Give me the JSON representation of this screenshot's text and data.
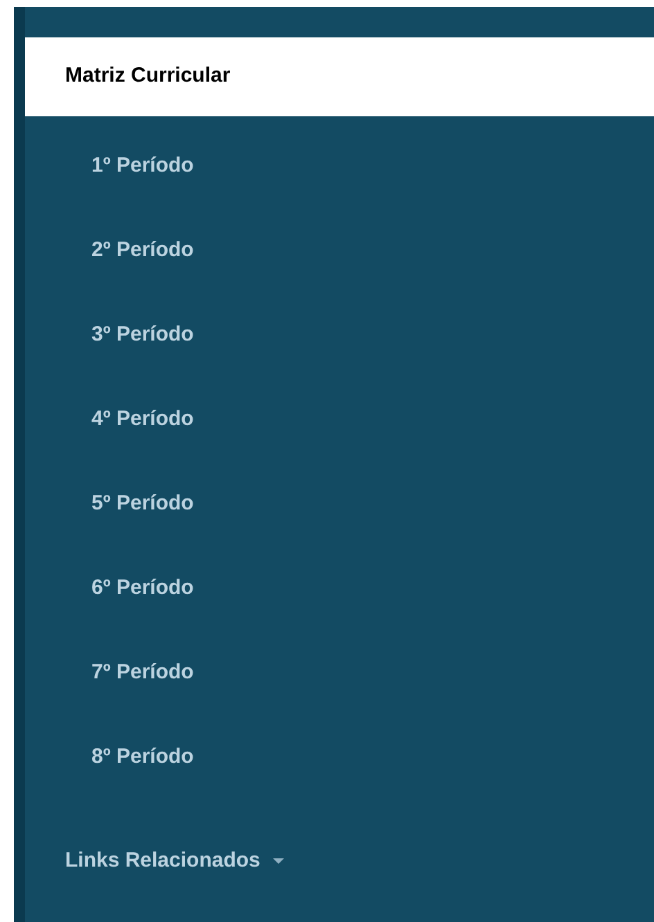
{
  "sidebar": {
    "items": [
      {
        "label": "Matriz Curricular",
        "selected": true,
        "children": [
          {
            "label": "1º Período",
            "selected": false
          },
          {
            "label": "2º Período",
            "selected": false
          },
          {
            "label": "3º Período",
            "selected": false
          },
          {
            "label": "4º Período",
            "selected": false
          },
          {
            "label": "5º Período",
            "selected": false
          },
          {
            "label": "6º Período",
            "selected": false
          },
          {
            "label": "7º Período",
            "selected": false
          },
          {
            "label": "8º Período",
            "selected": false
          }
        ]
      },
      {
        "label": "Links Relacionados",
        "selected": false,
        "kind": "dropdown"
      }
    ]
  }
}
